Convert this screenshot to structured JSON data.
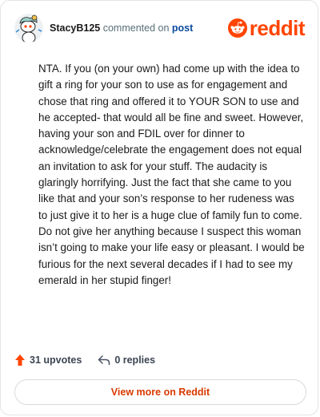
{
  "comment": {
    "author": "StacyB125",
    "action_text": "commented on",
    "target_link": "post",
    "body": "NTA. If you (on your own) had come up with the idea to gift a ring for your son to use as for engagement and chose that ring and offered it to YOUR SON to use and he accepted- that would all be fine and sweet. However, having your son and FDIL over for dinner to acknowledge/celebrate the engagement does not equal an invitation to ask for your stuff. The audacity is glaringly horrifying. Just the fact that she came to you like that and your son’s response to her rudeness was to just give it to her is a huge clue of family fun to come. Do not give her anything because I suspect this woman isn’t going to make your life easy or pleasant. I would be furious for the next several decades if I had to see my emerald in her stupid finger!"
  },
  "brand": {
    "name": "reddit",
    "color": "#ff4500"
  },
  "actions": {
    "upvotes_label": "31 upvotes",
    "replies_label": "0 replies",
    "upvote_icon": "arrow-up-icon",
    "reply_icon": "reply-arrow-icon"
  },
  "footer": {
    "view_more_label": "View more on Reddit"
  }
}
